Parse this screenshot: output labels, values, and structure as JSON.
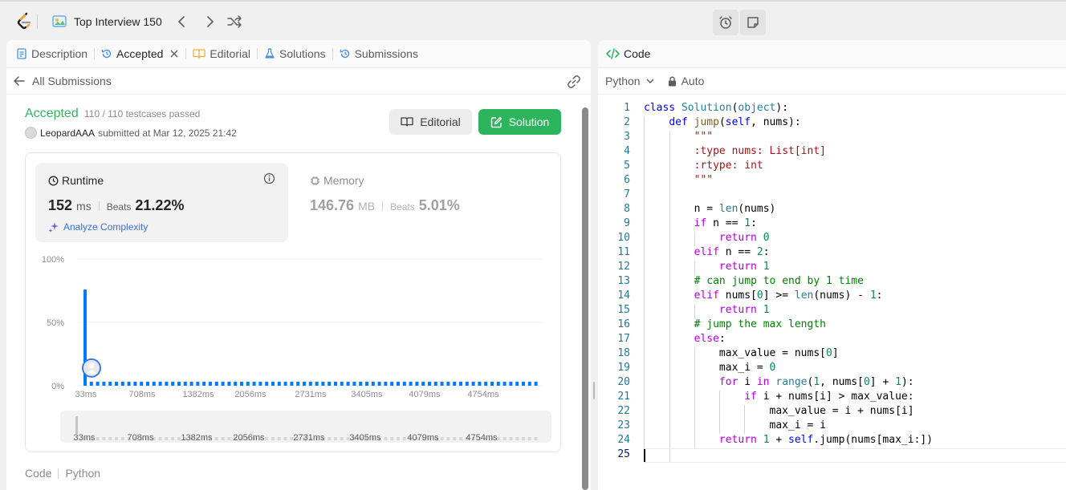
{
  "topnav": {
    "list_title": "Top Interview 150"
  },
  "tabs": [
    {
      "label": "Description"
    },
    {
      "label": "Accepted"
    },
    {
      "label": "Editorial"
    },
    {
      "label": "Solutions"
    },
    {
      "label": "Submissions"
    }
  ],
  "subbar": {
    "back_label": "All Submissions"
  },
  "submission": {
    "status": "Accepted",
    "testcases": "110 / 110 testcases passed",
    "user": "LeopardAAA",
    "submitted_text": "submitted at Mar 12, 2025 21:42",
    "editorial_btn": "Editorial",
    "solution_btn": "Solution"
  },
  "runtime": {
    "label": "Runtime",
    "value": "152",
    "unit": "ms",
    "beats_label": "Beats",
    "beats_value": "21.22%",
    "analyze_label": "Analyze Complexity"
  },
  "memory": {
    "label": "Memory",
    "value": "146.76",
    "unit": "MB",
    "beats_label": "Beats",
    "beats_value": "5.01%"
  },
  "chart_data": {
    "type": "bar",
    "y_ticks": [
      "100%",
      "50%",
      "0%"
    ],
    "x_ticks": [
      "33ms",
      "708ms",
      "1382ms",
      "2056ms",
      "2731ms",
      "3405ms",
      "4079ms",
      "4754ms"
    ],
    "ylim": [
      0,
      100
    ],
    "peak": {
      "x": "33ms",
      "value": 76
    },
    "user_marker": {
      "x": "33ms",
      "value": 14
    },
    "accent": "#007aff"
  },
  "code_lang": {
    "code_label": "Code",
    "lang_label": "Python"
  },
  "editor": {
    "tab_label": "Code",
    "language": "Python",
    "mode": "Auto",
    "lines": [
      "class Solution(object):",
      "    def jump(self, nums):",
      "        \"\"\"",
      "        :type nums: List[int]",
      "        :rtype: int",
      "        \"\"\"",
      "",
      "        n = len(nums)",
      "        if n == 1:",
      "            return 0",
      "        elif n == 2:",
      "            return 1",
      "        # can jump to end by 1 time",
      "        elif nums[0] >= len(nums) - 1:",
      "            return 1",
      "        # jump the max length",
      "        else:",
      "            max_value = nums[0]",
      "            max_i = 0",
      "            for i in range(1, nums[0] + 1):",
      "                if i + nums[i] > max_value:",
      "                    max_value = i + nums[i]",
      "                    max_i = i",
      "            return 1 + self.jump(nums[max_i:])",
      ""
    ]
  },
  "colors": {
    "accepted_green": "#2db55d",
    "link_blue": "#3a6fd8",
    "chart_blue": "#007aff"
  }
}
